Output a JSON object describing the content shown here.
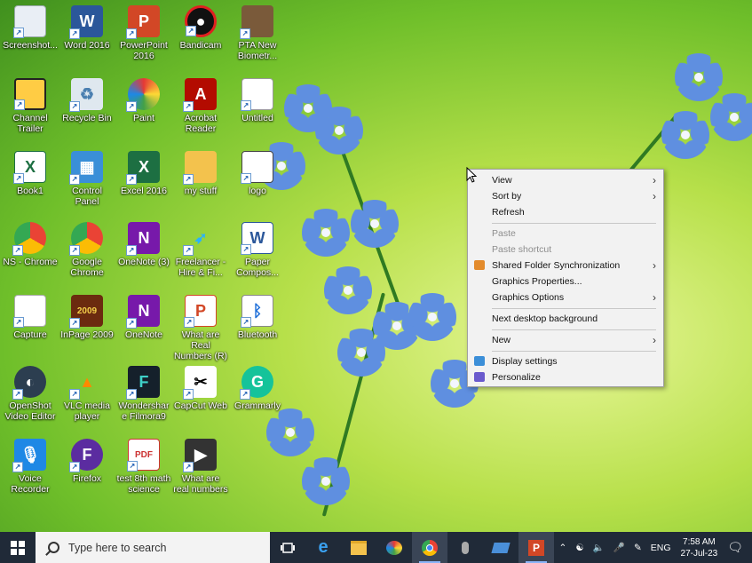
{
  "desktop_icons": [
    {
      "label": "Screenshot...",
      "icon": "screenshot-icon"
    },
    {
      "label": "Word 2016",
      "icon": "word-icon"
    },
    {
      "label": "PowerPoint 2016",
      "icon": "powerpoint-icon"
    },
    {
      "label": "Bandicam",
      "icon": "bandicam-icon"
    },
    {
      "label": "PTA New Biometr...",
      "icon": "pta-icon"
    },
    {
      "label": "Channel Trailer",
      "icon": "video-icon"
    },
    {
      "label": "Recycle Bin",
      "icon": "recycle-bin-icon"
    },
    {
      "label": "Paint",
      "icon": "paint-icon"
    },
    {
      "label": "Acrobat Reader",
      "icon": "acrobat-icon"
    },
    {
      "label": "Untitled",
      "icon": "image-file-icon"
    },
    {
      "label": "Book1",
      "icon": "excel-file-icon"
    },
    {
      "label": "Control Panel",
      "icon": "control-panel-icon"
    },
    {
      "label": "Excel 2016",
      "icon": "excel-icon"
    },
    {
      "label": "my stuff",
      "icon": "folder-icon"
    },
    {
      "label": "logo",
      "icon": "logo-image-icon"
    },
    {
      "label": "NS - Chrome",
      "icon": "chrome-icon"
    },
    {
      "label": "Google Chrome",
      "icon": "chrome-icon"
    },
    {
      "label": "OneNote (3)",
      "icon": "onenote-icon"
    },
    {
      "label": "Freelancer - Hire & Fi...",
      "icon": "freelancer-icon"
    },
    {
      "label": "Paper Compos...",
      "icon": "word-doc-icon"
    },
    {
      "label": "Capture",
      "icon": "capture-icon"
    },
    {
      "label": "InPage 2009",
      "icon": "inpage-icon"
    },
    {
      "label": "OneNote",
      "icon": "onenote-icon"
    },
    {
      "label": "What are Real Numbers (R)",
      "icon": "ppt-file-icon"
    },
    {
      "label": "Bluetooth",
      "icon": "bluetooth-icon"
    },
    {
      "label": "OpenShot Video Editor",
      "icon": "openshot-icon"
    },
    {
      "label": "VLC media player",
      "icon": "vlc-icon"
    },
    {
      "label": "Wondershare Filmora9",
      "icon": "filmora-icon"
    },
    {
      "label": "CapCut Web",
      "icon": "capcut-icon"
    },
    {
      "label": "Grammarly",
      "icon": "grammarly-icon"
    },
    {
      "label": "Voice Recorder",
      "icon": "voice-recorder-icon"
    },
    {
      "label": "Firefox",
      "icon": "firefox-icon"
    },
    {
      "label": "test 8th math science",
      "icon": "pdf-icon"
    },
    {
      "label": "What are real numbers",
      "icon": "video-file-icon"
    }
  ],
  "context_menu": {
    "items": [
      {
        "label": "View",
        "submenu": true,
        "disabled": false
      },
      {
        "label": "Sort by",
        "submenu": true,
        "disabled": false
      },
      {
        "label": "Refresh",
        "submenu": false,
        "disabled": false
      },
      {
        "separator": true
      },
      {
        "label": "Paste",
        "submenu": false,
        "disabled": true
      },
      {
        "label": "Paste shortcut",
        "submenu": false,
        "disabled": true
      },
      {
        "label": "Shared Folder Synchronization",
        "submenu": true,
        "disabled": false,
        "icon": "sync-icon"
      },
      {
        "label": "Graphics Properties...",
        "submenu": false,
        "disabled": false
      },
      {
        "label": "Graphics Options",
        "submenu": true,
        "disabled": false
      },
      {
        "separator": true
      },
      {
        "label": "Next desktop background",
        "submenu": false,
        "disabled": false
      },
      {
        "separator": true
      },
      {
        "label": "New",
        "submenu": true,
        "disabled": false
      },
      {
        "separator": true
      },
      {
        "label": "Display settings",
        "submenu": false,
        "disabled": false,
        "icon": "display-icon"
      },
      {
        "label": "Personalize",
        "submenu": false,
        "disabled": false,
        "icon": "personalize-icon"
      }
    ]
  },
  "taskbar": {
    "search_placeholder": "Type here to search",
    "language": "ENG",
    "time": "7:58 AM",
    "date": "27-Jul-23"
  },
  "colors": {
    "taskbar_bg": "#202a38",
    "menu_bg": "#f2f2f2",
    "accent": "#8ab4f8"
  }
}
